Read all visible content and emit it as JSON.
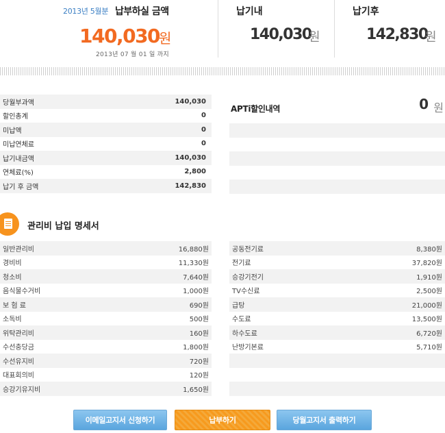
{
  "header": {
    "period": "2013년 5월분",
    "period_title": "납부하실 금액",
    "amount": "140,030",
    "amount_unit": "원",
    "due_date": "2013년 07 월 01 일 까지",
    "due": {
      "title": "납기내",
      "amount": "140,030",
      "unit": "원"
    },
    "after": {
      "title": "납기후",
      "amount": "142,830",
      "unit": "원"
    }
  },
  "summary": [
    {
      "label": "당월부과액",
      "value": "140,030"
    },
    {
      "label": "할인총계",
      "value": "0"
    },
    {
      "label": "미납액",
      "value": "0"
    },
    {
      "label": "미납연체료",
      "value": "0"
    },
    {
      "label": "납기내금액",
      "value": "140,030"
    },
    {
      "label": "연체료(%)",
      "value": "2,800"
    },
    {
      "label": "납기 후 금액",
      "value": "142,830"
    }
  ],
  "apt": {
    "title": "APTi할인내역",
    "amount": "0",
    "unit": "원"
  },
  "section": {
    "title": "관리비 납입 명세서"
  },
  "detail_left": [
    {
      "label": "일반관리비",
      "value": "16,880원"
    },
    {
      "label": "경비비",
      "value": "11,330원"
    },
    {
      "label": "청소비",
      "value": "7,640원"
    },
    {
      "label": "음식물수거비",
      "value": "1,000원"
    },
    {
      "label": "보 험 료",
      "value": "690원"
    },
    {
      "label": "소독비",
      "value": "500원"
    },
    {
      "label": "위탁관리비",
      "value": "160원"
    },
    {
      "label": "수선충당금",
      "value": "1,800원"
    },
    {
      "label": "수선유지비",
      "value": "720원"
    },
    {
      "label": "대표회의비",
      "value": "120원"
    },
    {
      "label": "승강기유지비",
      "value": "1,650원"
    }
  ],
  "detail_right": [
    {
      "label": "공동전기료",
      "value": "8,380원"
    },
    {
      "label": "전기료",
      "value": "37,820원"
    },
    {
      "label": "승강기전기",
      "value": "1,910원"
    },
    {
      "label": "TV수신료",
      "value": "2,500원"
    },
    {
      "label": "급탕",
      "value": "21,000원"
    },
    {
      "label": "수도료",
      "value": "13,500원"
    },
    {
      "label": "하수도료",
      "value": "6,720원"
    },
    {
      "label": "난방기본료",
      "value": "5,710원"
    }
  ],
  "buttons": {
    "email": "이메일고지서 신청하기",
    "pay": "납부하기",
    "print": "당월고지서 출력하기"
  },
  "colors": {
    "accent": "#f26a21",
    "button_blue": "#5aa5de",
    "button_orange": "#f79a1e",
    "row_alt": "#f2f2f2"
  },
  "icons": {
    "section": "document-icon"
  }
}
